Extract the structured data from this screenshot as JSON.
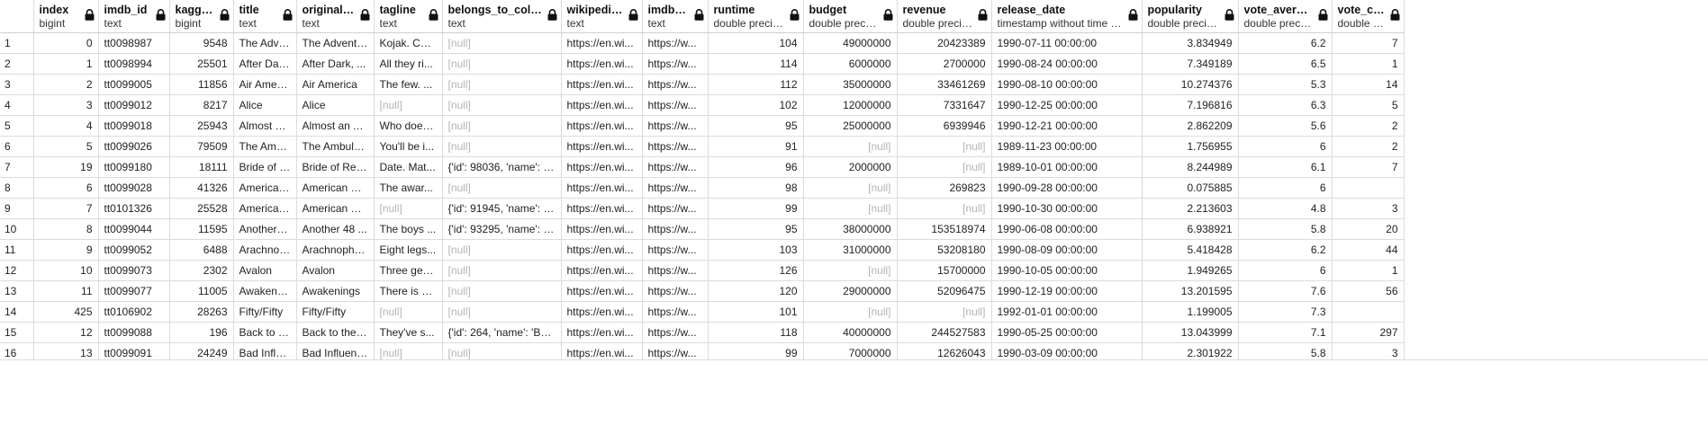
{
  "grid": {
    "columns": [
      {
        "name": "index",
        "type": "bigint",
        "align": "num"
      },
      {
        "name": "imdb_id",
        "type": "text",
        "align": "txt"
      },
      {
        "name": "kaggle_id",
        "type": "bigint",
        "align": "num"
      },
      {
        "name": "title",
        "type": "text",
        "align": "txt"
      },
      {
        "name": "original_title",
        "type": "text",
        "align": "txt"
      },
      {
        "name": "tagline",
        "type": "text",
        "align": "txt"
      },
      {
        "name": "belongs_to_collection",
        "type": "text",
        "align": "txt"
      },
      {
        "name": "wikipedia_url",
        "type": "text",
        "align": "txt"
      },
      {
        "name": "imdb_link",
        "type": "text",
        "align": "txt"
      },
      {
        "name": "runtime",
        "type": "double precision",
        "align": "num"
      },
      {
        "name": "budget",
        "type": "double precision",
        "align": "num"
      },
      {
        "name": "revenue",
        "type": "double precision",
        "align": "num"
      },
      {
        "name": "release_date",
        "type": "timestamp without time zone",
        "align": "txt"
      },
      {
        "name": "popularity",
        "type": "double precision",
        "align": "num"
      },
      {
        "name": "vote_average",
        "type": "double precision",
        "align": "num"
      },
      {
        "name": "vote_count",
        "type": "double precision",
        "align": "num"
      }
    ],
    "null_label": "[null]",
    "rows": [
      [
        "1",
        "0",
        "tt0098987",
        "9548",
        "The Adve...",
        "The Adventu...",
        "Kojak. Col...",
        null,
        "https://en.wi...",
        "https://w...",
        "104",
        "49000000",
        "20423389",
        "1990-07-11 00:00:00",
        "3.834949",
        "6.2",
        "7"
      ],
      [
        "2",
        "1",
        "tt0098994",
        "25501",
        "After Dar...",
        "After Dark, ...",
        "All they ri...",
        null,
        "https://en.wi...",
        "https://w...",
        "114",
        "6000000",
        "2700000",
        "1990-08-24 00:00:00",
        "7.349189",
        "6.5",
        "1"
      ],
      [
        "3",
        "2",
        "tt0099005",
        "11856",
        "Air Ameri...",
        "Air America",
        "The few. ...",
        null,
        "https://en.wi...",
        "https://w...",
        "112",
        "35000000",
        "33461269",
        "1990-08-10 00:00:00",
        "10.274376",
        "5.3",
        "14"
      ],
      [
        "4",
        "3",
        "tt0099012",
        "8217",
        "Alice",
        "Alice",
        null,
        null,
        "https://en.wi...",
        "https://w...",
        "102",
        "12000000",
        "7331647",
        "1990-12-25 00:00:00",
        "7.196816",
        "6.3",
        "5"
      ],
      [
        "5",
        "4",
        "tt0099018",
        "25943",
        "Almost an ...",
        "Almost an A...",
        "Who does...",
        null,
        "https://en.wi...",
        "https://w...",
        "95",
        "25000000",
        "6939946",
        "1990-12-21 00:00:00",
        "2.862209",
        "5.6",
        "2"
      ],
      [
        "6",
        "5",
        "tt0099026",
        "79509",
        "The Amb...",
        "The Ambula...",
        "You'll be i...",
        null,
        "https://en.wi...",
        "https://w...",
        "91",
        null,
        null,
        "1989-11-23 00:00:00",
        "1.756955",
        "6",
        "2"
      ],
      [
        "7",
        "19",
        "tt0099180",
        "18111",
        "Bride of R...",
        "Bride of Re-...",
        "Date. Mat...",
        "{'id': 98036, 'name': 'R...",
        "https://en.wi...",
        "https://w...",
        "96",
        "2000000",
        null,
        "1989-10-01 00:00:00",
        "8.244989",
        "6.1",
        "7"
      ],
      [
        "8",
        "6",
        "tt0099028",
        "41326",
        "American...",
        "American Dr...",
        "The awar...",
        null,
        "https://en.wi...",
        "https://w...",
        "98",
        null,
        "269823",
        "1990-09-28 00:00:00",
        "0.075885",
        "6",
        ""
      ],
      [
        "9",
        "7",
        "tt0101326",
        "25528",
        "American...",
        "American Ni...",
        null,
        "{'id': 91945, 'name': 'A...",
        "https://en.wi...",
        "https://w...",
        "99",
        null,
        null,
        "1990-10-30 00:00:00",
        "2.213603",
        "4.8",
        "3"
      ],
      [
        "10",
        "8",
        "tt0099044",
        "11595",
        "Another 4...",
        "Another 48 ...",
        "The boys ...",
        "{'id': 93295, 'name': '4...",
        "https://en.wi...",
        "https://w...",
        "95",
        "38000000",
        "153518974",
        "1990-06-08 00:00:00",
        "6.938921",
        "5.8",
        "20"
      ],
      [
        "11",
        "9",
        "tt0099052",
        "6488",
        "Arachnop...",
        "Arachnopho...",
        "Eight legs...",
        null,
        "https://en.wi...",
        "https://w...",
        "103",
        "31000000",
        "53208180",
        "1990-08-09 00:00:00",
        "5.418428",
        "6.2",
        "44"
      ],
      [
        "12",
        "10",
        "tt0099073",
        "2302",
        "Avalon",
        "Avalon",
        "Three gen...",
        null,
        "https://en.wi...",
        "https://w...",
        "126",
        null,
        "15700000",
        "1990-10-05 00:00:00",
        "1.949265",
        "6",
        "1"
      ],
      [
        "13",
        "11",
        "tt0099077",
        "11005",
        "Awakenin...",
        "Awakenings",
        "There is n...",
        null,
        "https://en.wi...",
        "https://w...",
        "120",
        "29000000",
        "52096475",
        "1990-12-19 00:00:00",
        "13.201595",
        "7.6",
        "56"
      ],
      [
        "14",
        "425",
        "tt0106902",
        "28263",
        "Fifty/Fifty",
        "Fifty/Fifty",
        null,
        null,
        "https://en.wi...",
        "https://w...",
        "101",
        null,
        null,
        "1992-01-01 00:00:00",
        "1.199005",
        "7.3",
        ""
      ],
      [
        "15",
        "12",
        "tt0099088",
        "196",
        "Back to th...",
        "Back to the ...",
        "They've s...",
        "{'id': 264, 'name': 'Bac...",
        "https://en.wi...",
        "https://w...",
        "118",
        "40000000",
        "244527583",
        "1990-05-25 00:00:00",
        "13.043999",
        "7.1",
        "297"
      ],
      [
        "16",
        "13",
        "tt0099091",
        "24249",
        "Bad Influ...",
        "Bad Influence",
        null,
        null,
        "https://en.wi...",
        "https://w...",
        "99",
        "7000000",
        "12626043",
        "1990-03-09 00:00:00",
        "2.301922",
        "5.8",
        "3"
      ]
    ]
  }
}
